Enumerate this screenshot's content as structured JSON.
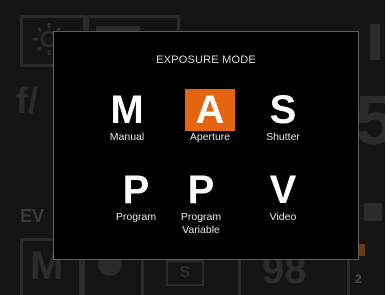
{
  "background": {
    "aperture_prefix": "f/",
    "ev_label": "EV",
    "mode_indicator": "M",
    "shots_remaining": "98",
    "right_number": "5",
    "s_badge": "S",
    "card_slot": "2"
  },
  "dialog": {
    "title": "EXPOSURE MODE",
    "modes": [
      {
        "letter": "M",
        "label": "Manual",
        "selected": false
      },
      {
        "letter": "A",
        "label": "Aperture",
        "selected": true
      },
      {
        "letter": "S",
        "label": "Shutter",
        "selected": false
      },
      {
        "letter": "P",
        "label": "Program",
        "selected": false
      },
      {
        "letter": "P",
        "label": "Program Variable",
        "selected": false
      },
      {
        "letter": "V",
        "label": "Video",
        "selected": false
      }
    ]
  },
  "colors": {
    "accent": "#e5640f",
    "background": "#141414",
    "dialog": "#000000"
  },
  "icons": [
    "brightness-icon",
    "battery-icon",
    "exposure-compensation-icon",
    "record-dot-icon"
  ]
}
